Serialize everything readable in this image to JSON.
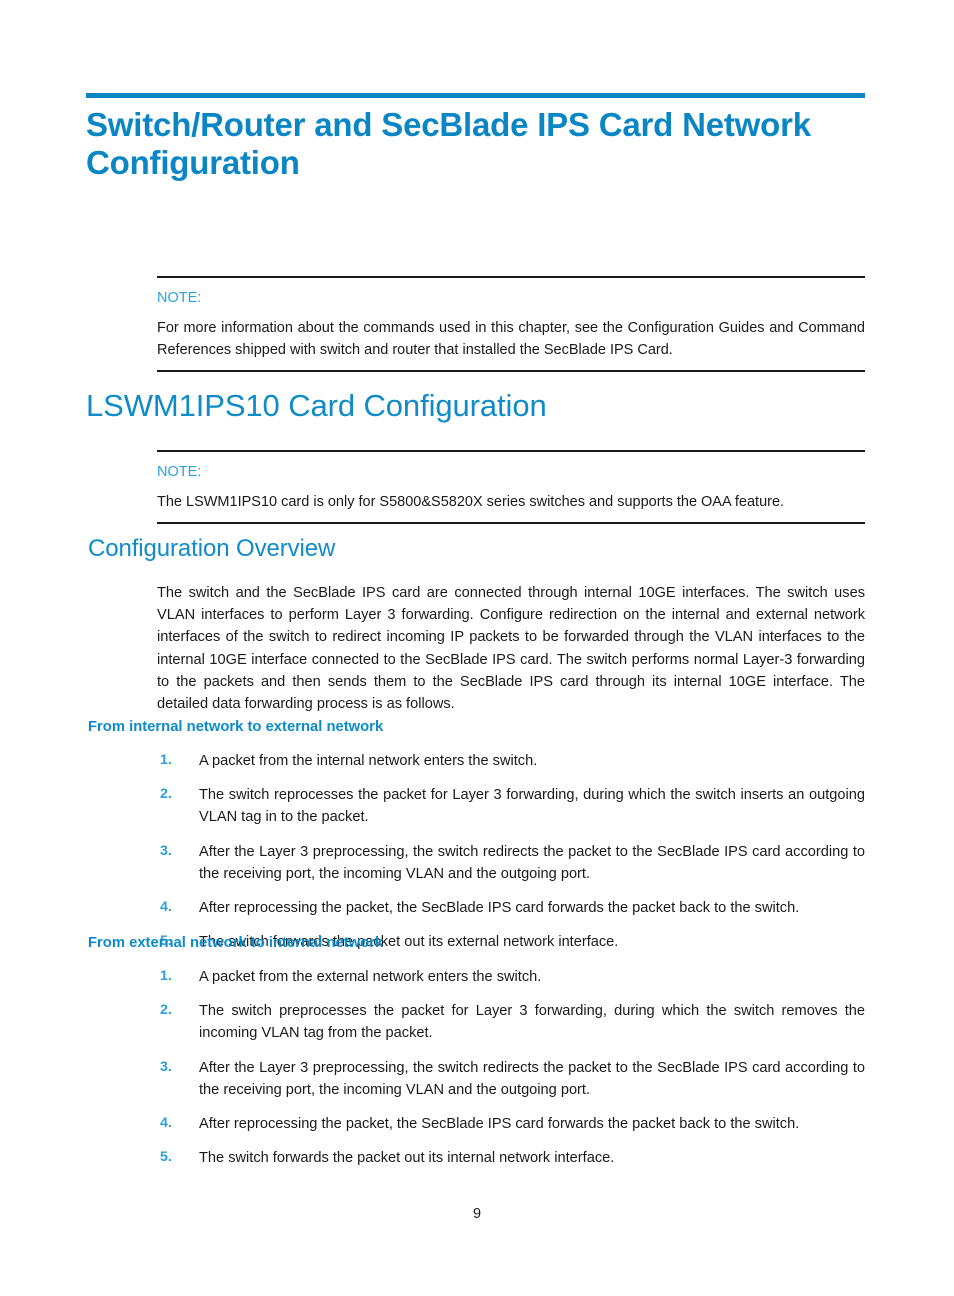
{
  "document": {
    "chapter_title": "Switch/Router and SecBlade IPS Card Network Configuration",
    "page_number": "9",
    "accent_color": "#0b86c5",
    "heading_color": "#0f8bc8",
    "note_label_color": "#29a3dc",
    "list_marker_color": "#2a9fd6",
    "body_color": "#1a1a1a"
  },
  "notes": {
    "chapter_note": {
      "label": "NOTE:",
      "body": "For more information about the commands used in this chapter, see the Configuration Guides and Command References shipped with switch and router that installed the SecBlade IPS Card."
    },
    "card_note": {
      "label": "NOTE:",
      "body": "The LSWM1IPS10 card is only for S5800&S5820X series switches and supports the OAA feature."
    }
  },
  "sections": {
    "card_configuration": {
      "title": "LSWM1IPS10 Card Configuration"
    },
    "configuration_overview": {
      "title": "Configuration Overview",
      "paragraph": "The switch and the SecBlade IPS card are connected through internal 10GE interfaces. The switch uses VLAN interfaces to perform Layer 3 forwarding. Configure redirection on the internal and external network interfaces of the switch to redirect incoming IP packets to be forwarded through the VLAN interfaces to the internal 10GE interface connected to the SecBlade IPS card. The switch performs normal Layer-3 forwarding to the packets and then sends them to the SecBlade IPS card through its internal 10GE interface. The detailed data forwarding process is as follows."
    }
  },
  "internal_to_external": {
    "heading": "From internal network to external network",
    "steps": [
      {
        "num": "1.",
        "text": "A packet from the internal network enters the switch."
      },
      {
        "num": "2.",
        "text": "The switch reprocesses the packet for Layer 3 forwarding, during which the switch inserts an outgoing VLAN tag in to the packet."
      },
      {
        "num": "3.",
        "text": "After the Layer 3 preprocessing, the switch redirects the packet to the SecBlade IPS card according to the receiving port, the incoming VLAN and the outgoing port."
      },
      {
        "num": "4.",
        "text": "After reprocessing the packet, the SecBlade IPS card forwards the packet back to the switch."
      },
      {
        "num": "5.",
        "text": "The switch forwards the packet out its external network interface."
      }
    ]
  },
  "external_to_internal": {
    "heading": "From external network to internal network",
    "steps": [
      {
        "num": "1.",
        "text": "A packet from the external network enters the switch."
      },
      {
        "num": "2.",
        "text": "The switch preprocesses the packet for Layer 3 forwarding, during which the switch removes the incoming VLAN tag from the packet."
      },
      {
        "num": "3.",
        "text": "After the Layer 3 preprocessing, the switch redirects the packet to the SecBlade IPS card according to the receiving port, the incoming VLAN and the outgoing port."
      },
      {
        "num": "4.",
        "text": "After reprocessing the packet, the SecBlade IPS card forwards the packet back to the switch."
      },
      {
        "num": "5.",
        "text": "The switch forwards the packet out its internal network interface."
      }
    ]
  }
}
